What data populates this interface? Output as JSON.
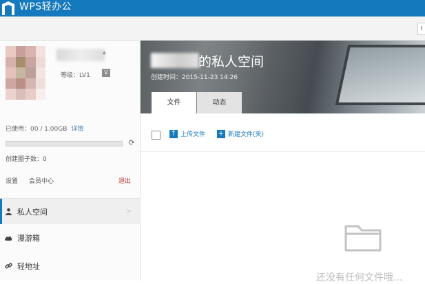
{
  "app": {
    "title": "WPS轻办公"
  },
  "user": {
    "level": "等级：LV1",
    "level_badge": "V"
  },
  "storage": {
    "usage": "已使用：00 / 1.00GB",
    "detail_link": "详情",
    "used_fraction": 0
  },
  "circles": {
    "created_count": "创建圈子数：0"
  },
  "account_links": {
    "settings": "设置",
    "member_center": "会员中心",
    "logout": "退出"
  },
  "nav": {
    "items": [
      {
        "label": "私人空间",
        "icon": "person-icon",
        "active": true
      },
      {
        "label": "漫游箱",
        "icon": "cloud-icon",
        "active": false
      },
      {
        "label": "轻地址",
        "icon": "link-icon",
        "active": false
      }
    ]
  },
  "space": {
    "title": "的私人空间",
    "created": "创建时间：2015-11-23 14:26",
    "tabs": [
      {
        "label": "文件",
        "active": true
      },
      {
        "label": "动态",
        "active": false
      }
    ]
  },
  "toolbar": {
    "upload": "上传文件",
    "new_file": "新建文件(夹)",
    "right_button": "t"
  },
  "empty_state": {
    "text": "还没有任何文件哦..."
  },
  "colors": {
    "brand": "#1479bd",
    "logout": "#c23531"
  }
}
